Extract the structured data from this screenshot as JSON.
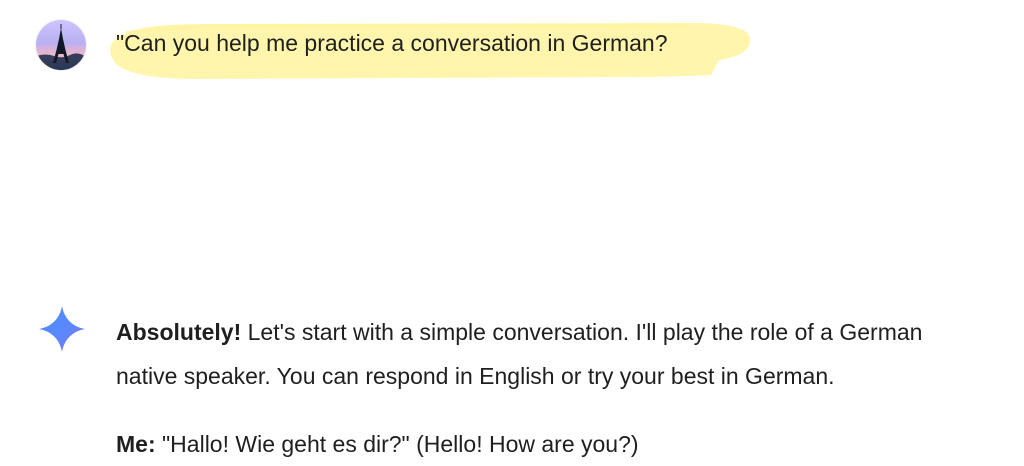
{
  "conversation": {
    "user_message": {
      "avatar": "eiffel-tower-avatar",
      "text": "\"Can you help me practice a conversation in German?"
    },
    "assistant_message": {
      "icon": "gemini-sparkle-icon",
      "lead_bold": "Absolutely!",
      "line1_rest": " Let's start with a simple conversation. I'll play the role of a German",
      "line2": "native speaker. You can respond in English or try your best in German.",
      "me_label": "Me:",
      "me_text": " \"Hallo! Wie geht es dir?\" (Hello! How are you?)"
    }
  },
  "colors": {
    "highlight": "#fff4a8",
    "spark_blue": "#4b8df8",
    "spark_violet": "#8f6bf0",
    "text": "#1f1f1f"
  }
}
